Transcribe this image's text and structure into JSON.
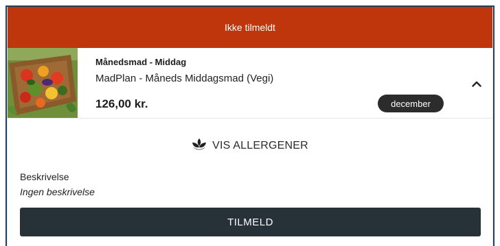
{
  "banner": {
    "status": "Ikke tilmeldt",
    "color": "#bf360c"
  },
  "product": {
    "title": "Månedsmad - Middag",
    "subtitle": "MadPlan - Måneds Middagsmad (Vegi)",
    "price": "126,00 kr.",
    "month_badge": "december",
    "image_icon": "vegetable-salad-image",
    "expand_icon": "chevron-up-icon"
  },
  "allergens": {
    "label": "VIS ALLERGENER",
    "icon": "leaf-icon"
  },
  "description": {
    "label": "Beskrivelse",
    "value": "Ingen beskrivelse"
  },
  "actions": {
    "signup_label": "TILMELD",
    "signup_color": "#263238"
  }
}
